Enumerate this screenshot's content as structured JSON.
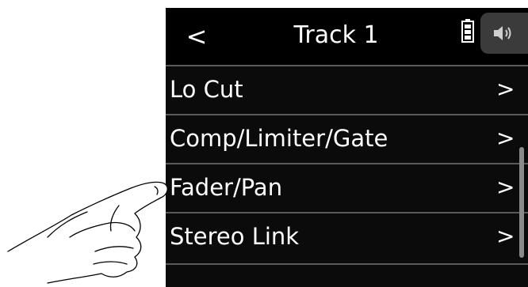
{
  "header": {
    "back_symbol": "<",
    "title": "Track 1",
    "battery_icon": "battery-icon",
    "speaker_icon": "speaker-icon"
  },
  "menu": {
    "items": [
      {
        "label": "Lo Cut",
        "chevron": ">"
      },
      {
        "label": "Comp/Limiter/Gate",
        "chevron": ">"
      },
      {
        "label": "Fader/Pan",
        "chevron": ">"
      },
      {
        "label": "Stereo Link",
        "chevron": ">"
      }
    ]
  },
  "colors": {
    "background": "#0b0b0b",
    "header": "#000000",
    "divider": "#5a5a5a",
    "text": "#ffffff",
    "speaker_tab": "#3b3b3b",
    "scrollbar": "#8a8a8a"
  }
}
